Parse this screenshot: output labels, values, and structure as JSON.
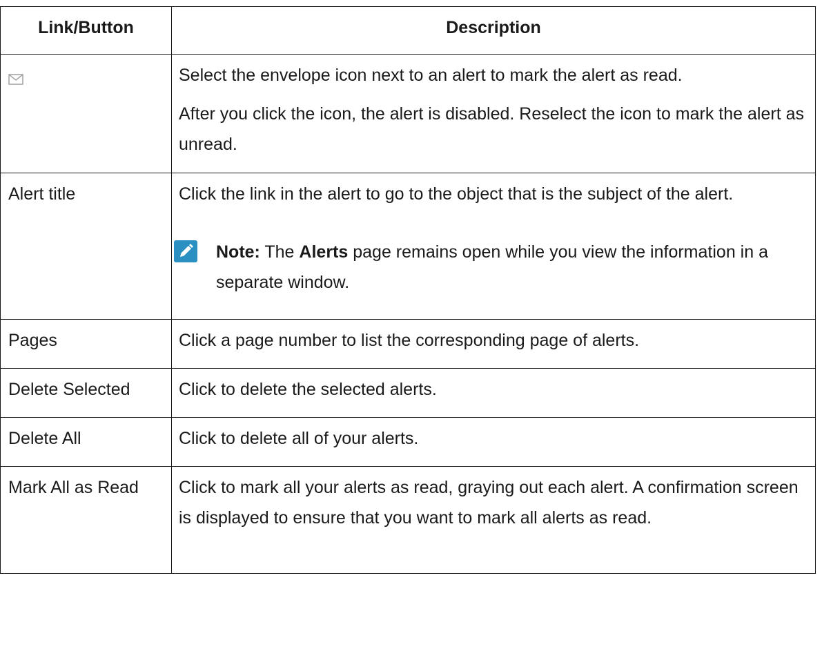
{
  "table": {
    "headers": {
      "link": "Link/Button",
      "description": "Description"
    },
    "rows": [
      {
        "link_icon": "envelope-icon",
        "desc": [
          "Select the envelope icon next to an alert to mark the alert as read.",
          "After you click the icon, the alert is disabled. Reselect the icon to mark the alert as unread."
        ]
      },
      {
        "link": "Alert title",
        "desc": [
          "Click the link in the alert to go to the object that is the subject of the alert."
        ],
        "note": {
          "icon": "pencil-note-icon",
          "label": "Note:",
          "text_before": " The ",
          "bold": "Alerts",
          "text_after": " page remains open while you view the information in a separate window."
        }
      },
      {
        "link": "Pages",
        "desc": [
          "Click a page number to list the corresponding page of alerts."
        ]
      },
      {
        "link": "Delete Selected",
        "desc": [
          "Click to delete the selected alerts."
        ]
      },
      {
        "link": "Delete All",
        "desc": [
          "Click to delete all of your alerts."
        ]
      },
      {
        "link": "Mark All as Read",
        "desc": [
          "Click to mark all your alerts as read, graying out each alert. A confirmation screen is displayed to ensure that you want to mark all alerts as read."
        ]
      }
    ]
  },
  "colors": {
    "text": "#1a1a1a",
    "border": "#1a1a1a",
    "note_icon_bg": "#2a8fc1",
    "envelope_icon": "#9a9a9a"
  }
}
